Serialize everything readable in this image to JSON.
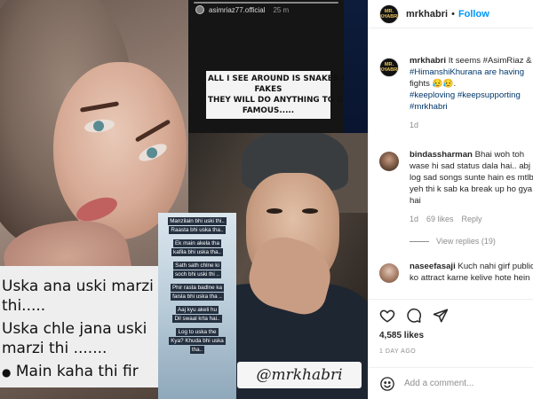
{
  "post_image": {
    "girl_caption_lines": [
      "Uska ana uski marzi",
      "thi.....",
      "Uska chle jana uski",
      "marzi thi .......",
      "Main kaha thi fir"
    ],
    "story": {
      "username": "asimriaz77.official",
      "time": "25 m",
      "text_lines": [
        "ALL I SEE AROUND IS SNAKES AND",
        "FAKES",
        "THEY WILL DO ANYTHING TO GET",
        "FAMOUS....."
      ]
    },
    "quote_lines": [
      "Manzilain bhi uski thi..",
      "Raasta bhi uska tha..",
      "Ek main akela tha",
      "kafila bhi uska tha..",
      "Sath sath chlne ki",
      "soch bhi uski thi ..",
      "Phir rasta badlne ka",
      "faisla bhi uska tha ..",
      "Aaj kyu akeli hu",
      "Dil swaal krta hai..",
      "Log to uska the",
      "Kya? Khuda bhi uska",
      "tha.."
    ],
    "watermark": "@mrkhabri"
  },
  "header": {
    "username": "mrkhabri",
    "separator": "•",
    "follow_label": "Follow",
    "avatar_lines": [
      "MR.",
      "KHABRI"
    ]
  },
  "caption": {
    "username": "mrkhabri",
    "lines": [
      "It seems #AsimRiaz &",
      "#HimanshiKhurana are having",
      "fights 😥😥.",
      "#keeploving #keepsupporting",
      "#mrkhabri"
    ],
    "time": "1d"
  },
  "comments": [
    {
      "username": "bindassharman",
      "lines": [
        "Bhai woh toh",
        "wase hi sad status dala hai.. abj",
        "log sad songs sunte hain es mtlb",
        "yeh thi k sab ka break up ho gya",
        "hai"
      ],
      "time": "1d",
      "likes": "69 likes",
      "reply_label": "Reply",
      "view_replies": "View replies (19)"
    },
    {
      "username": "naseefasaji",
      "lines": [
        "Kuch nahi girf public",
        "ko attract karne kelive hote hein"
      ]
    }
  ],
  "likes_count": "4,585 likes",
  "date_label": "1 DAY AGO",
  "add_comment": {
    "placeholder": "Add a comment..."
  },
  "colors": {
    "link": "#00376b",
    "follow": "#0095f6",
    "muted": "#8e8e8e",
    "text": "#262626"
  }
}
